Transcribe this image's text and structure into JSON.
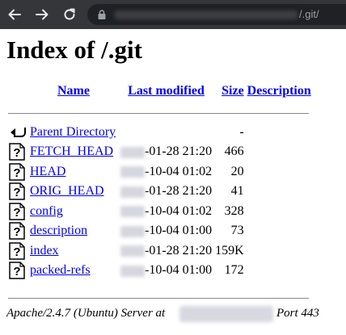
{
  "browser": {
    "url_visible_suffix": "/.git/"
  },
  "page": {
    "title": "Index of /.git",
    "columns": {
      "name": "Name",
      "last_modified": "Last modified",
      "size": "Size",
      "description": "Description"
    },
    "parent": {
      "label": "Parent Directory",
      "size": "-"
    },
    "entries": [
      {
        "name": "FETCH_HEAD",
        "modified": "-01-28 21:20",
        "size": "466"
      },
      {
        "name": "HEAD",
        "modified": "-10-04 01:02",
        "size": "20"
      },
      {
        "name": "ORIG_HEAD",
        "modified": "-01-28 21:20",
        "size": "41"
      },
      {
        "name": "config",
        "modified": "-10-04 01:02",
        "size": "328"
      },
      {
        "name": "description",
        "modified": "-10-04 01:00",
        "size": "73"
      },
      {
        "name": "index",
        "modified": "-01-28 21:20",
        "size": "159K"
      },
      {
        "name": "packed-refs",
        "modified": "-10-04 01:00",
        "size": "172"
      }
    ],
    "footer": {
      "server": "Apache/2.4.7 (Ubuntu) Server at",
      "port": "Port 443"
    }
  }
}
